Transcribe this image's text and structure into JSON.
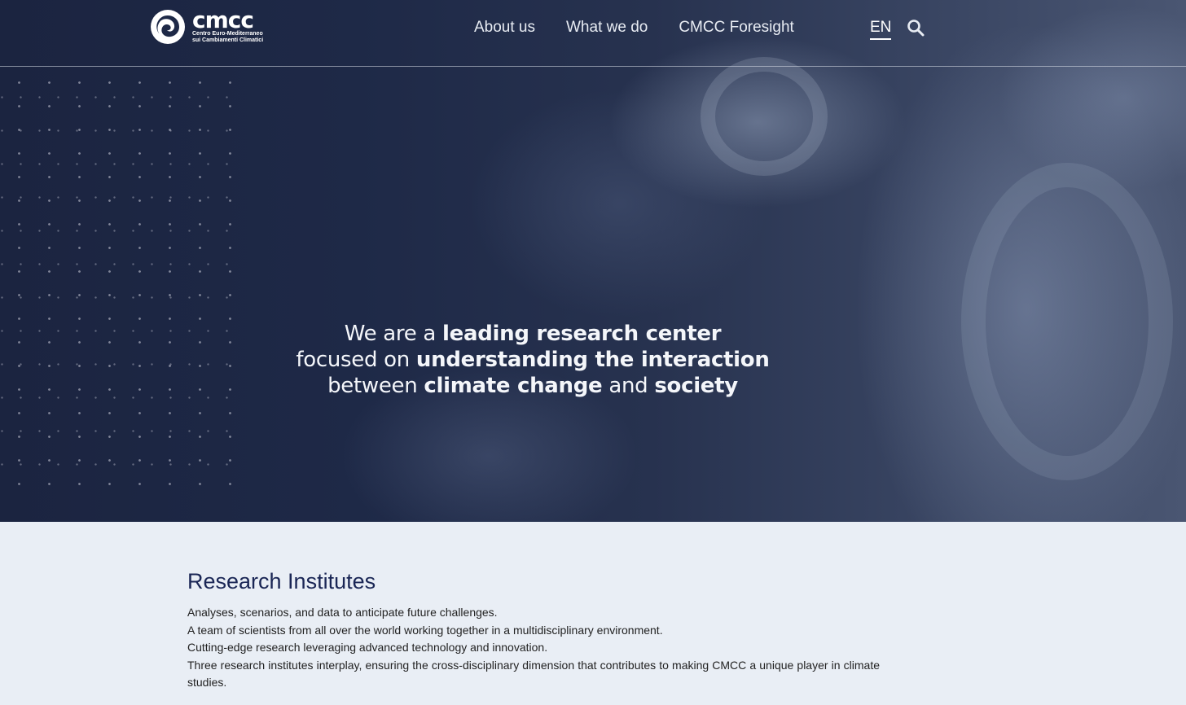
{
  "header": {
    "logo": {
      "word": "cmcc",
      "subtitle_line1": "Centro Euro-Mediterraneo",
      "subtitle_line2": "sui Cambiamenti Climatici"
    },
    "nav": [
      {
        "label": "About us"
      },
      {
        "label": "What we do"
      },
      {
        "label": "CMCC Foresight"
      }
    ],
    "language": "EN",
    "search_icon": "search-icon"
  },
  "hero": {
    "line1": {
      "t1": "We are a ",
      "b1": "leading research center"
    },
    "line2": {
      "t1": "focused on ",
      "b1": "understanding the interaction"
    },
    "line3": {
      "t1": "between ",
      "b1": "climate change",
      "t2": " and ",
      "b2": "society"
    }
  },
  "research": {
    "title": "Research Institutes",
    "paragraphs": [
      "Analyses, scenarios, and data to anticipate future challenges.",
      "A team of scientists from all over the world working together in a multidisciplinary environment.",
      "Cutting-edge research leveraging advanced technology and innovation.",
      "Three research institutes interplay, ensuring the cross-disciplinary dimension that contributes to making CMCC a unique player in climate studies."
    ]
  },
  "colors": {
    "hero_dark": "#1e2947",
    "section_bg": "#e9eef5",
    "title": "#1a2655"
  }
}
